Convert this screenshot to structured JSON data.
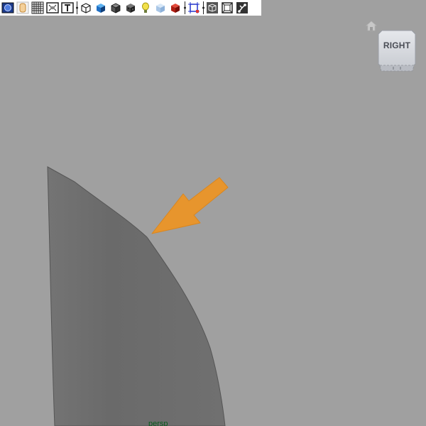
{
  "toolbar": {
    "buttons": [
      {
        "name": "camera-select-icon"
      },
      {
        "name": "lock-camera-icon"
      },
      {
        "name": "grid-icon"
      },
      {
        "name": "film-gate-icon"
      },
      {
        "name": "resolution-gate-icon"
      },
      {
        "name": "wireframe-icon"
      },
      {
        "name": "smooth-shade-icon"
      },
      {
        "name": "shaded-wireframe-icon"
      },
      {
        "name": "textured-icon"
      },
      {
        "name": "lighting-icon"
      },
      {
        "name": "shadows-icon"
      },
      {
        "name": "xray-icon"
      },
      {
        "name": "isolate-select-icon"
      },
      {
        "name": "backface-culling-icon"
      },
      {
        "name": "frame-all-icon"
      },
      {
        "name": "symmetry-icon"
      }
    ]
  },
  "viewcube": {
    "label": "RIGHT"
  },
  "camera": {
    "label": "persp"
  },
  "colors": {
    "background": "#a0a0a0",
    "mesh": "#6d6d6d",
    "arrow": "#e7952d"
  }
}
